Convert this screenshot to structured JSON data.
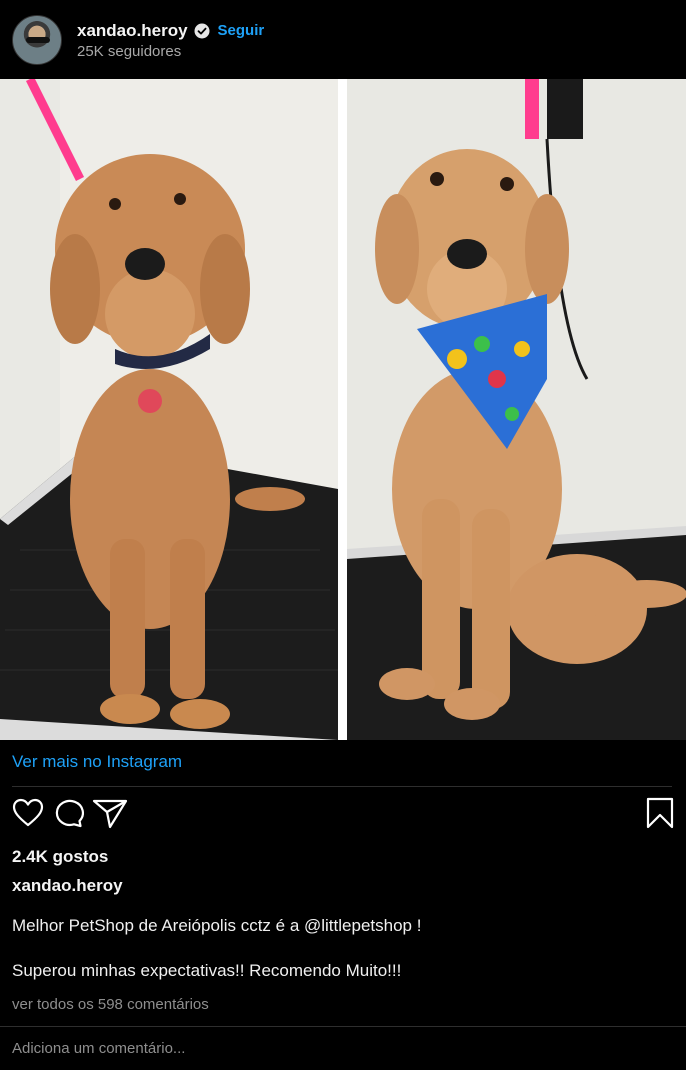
{
  "post": {
    "username": "xandao.heroy",
    "follow_label": "Seguir",
    "followers": "25K seguidores",
    "avatar_icon": "user-avatar",
    "verified_icon": "verified-badge-icon",
    "media": {
      "left_photo": "dog-before-grooming",
      "right_photo": "dog-after-grooming-with-bandana"
    },
    "view_more": "Ver mais no Instagram",
    "icons": [
      "heart-icon",
      "comment-icon",
      "share-icon",
      "bookmark-icon"
    ],
    "likes": "2.4K gostos",
    "caption_user": "xandao.heroy",
    "caption_line1": "Melhor PetShop de Areiópolis cctz é a @littlepetshop !",
    "caption_line2": "Superou minhas expectativas!! Recomendo Muito!!!",
    "view_comments": "ver todos os 598 comentários",
    "comment_placeholder": "Adiciona um comentário..."
  },
  "colors": {
    "background": "#000000",
    "link": "#1ea1f7",
    "muted": "#8e8e8e"
  }
}
